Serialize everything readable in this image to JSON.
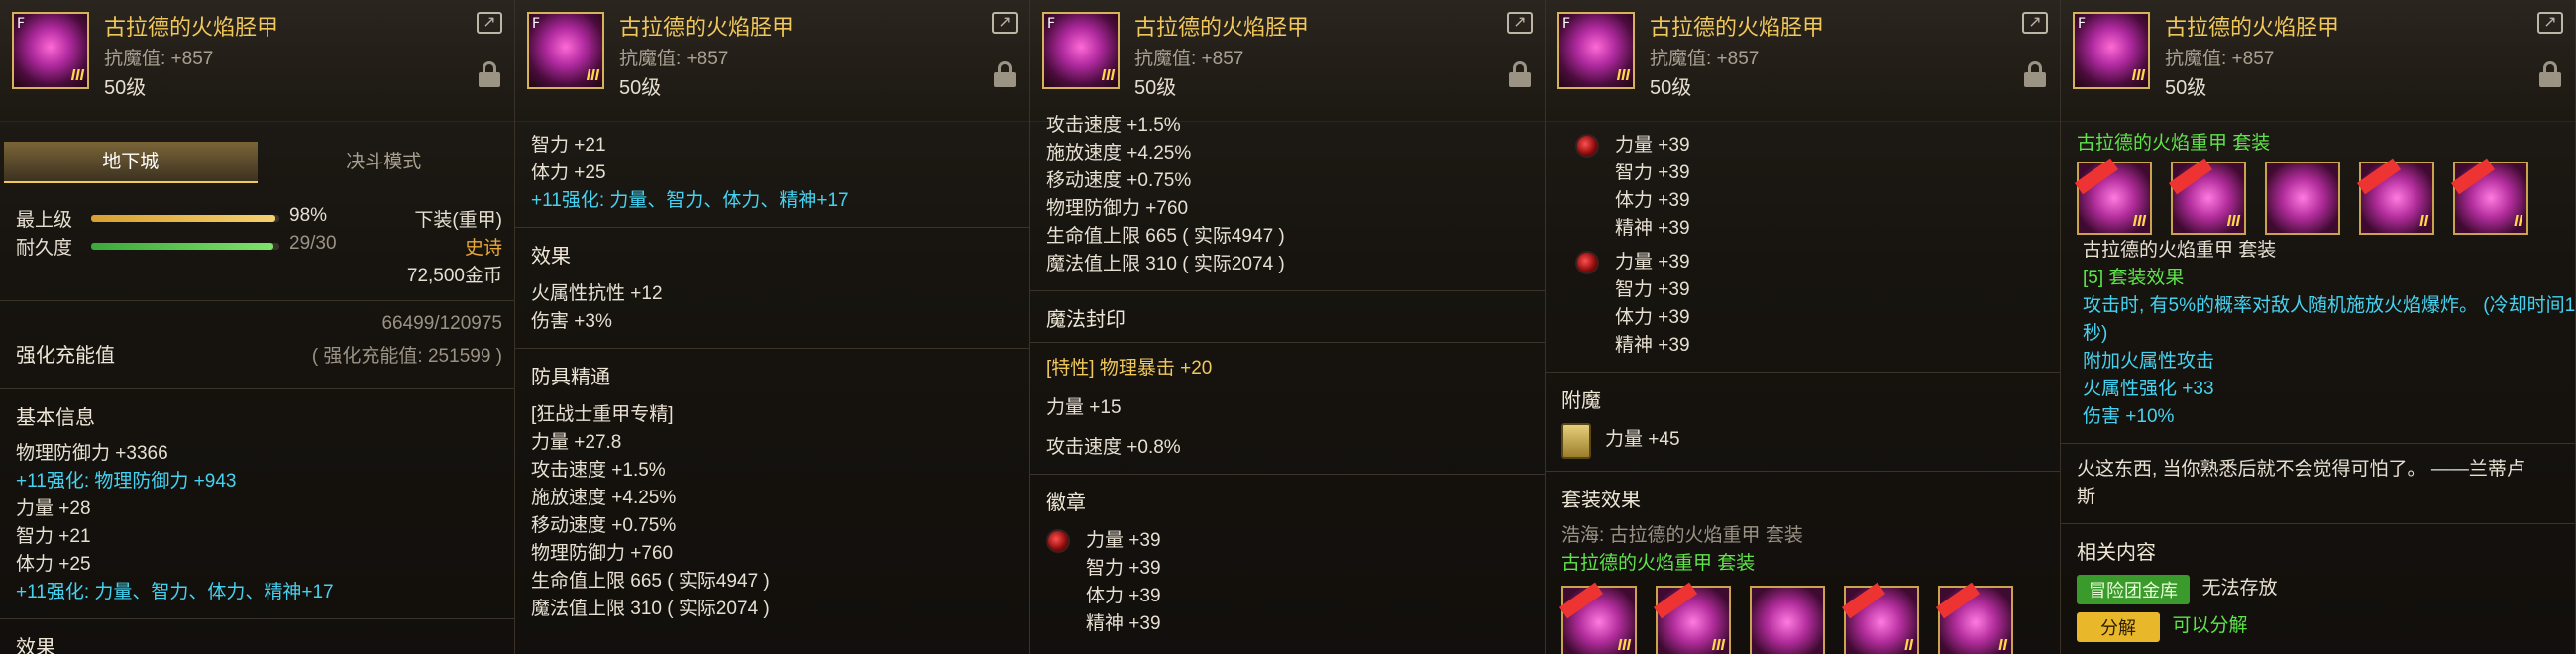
{
  "header": {
    "item_name": "古拉德的火焰胫甲",
    "resist": "抗魔值: +857",
    "level": "50级",
    "icon_tag": "F",
    "icon_grade": "III"
  },
  "panel1": {
    "tabs": [
      "地下城",
      "决斗模式"
    ],
    "grade_label": "最上级",
    "grade_value": "98%",
    "grade_progress": 0.98,
    "durability_label": "耐久度",
    "durability_value": "29/30",
    "durability_progress": 0.967,
    "slot_type": "下装(重甲)",
    "rarity": "史诗",
    "price": "72,500金币",
    "charge_label": "强化充能值",
    "charge_value": "66499/120975",
    "charge_note": "( 强化充能值: 251599 )",
    "basic_title": "基本信息",
    "basic_lines": [
      {
        "text": "物理防御力 +3366",
        "color": "white"
      },
      {
        "text": "+11强化: 物理防御力 +943",
        "color": "blue"
      },
      {
        "text": "力量 +28",
        "color": "white"
      },
      {
        "text": "智力 +21",
        "color": "white"
      },
      {
        "text": "体力 +25",
        "color": "white"
      },
      {
        "text": "+11强化: 力量、智力、体力、精神+17",
        "color": "blue"
      }
    ],
    "effect_title": "效果"
  },
  "panel2": {
    "top_lines": [
      {
        "text": "智力 +21",
        "color": "white"
      },
      {
        "text": "体力 +25",
        "color": "white"
      },
      {
        "text": "+11强化: 力量、智力、体力、精神+17",
        "color": "blue"
      }
    ],
    "effect_title": "效果",
    "effect_lines": [
      "火属性抗性 +12",
      "伤害 +3%"
    ],
    "mastery_title": "防具精通",
    "mastery_lines": [
      "[狂战士重甲专精]",
      "力量 +27.8",
      "攻击速度 +1.5%",
      "施放速度 +4.25%",
      "移动速度 +0.75%",
      "物理防御力 +760",
      "生命值上限 665 ( 实际4947 )",
      "魔法值上限 310 ( 实际2074 )"
    ]
  },
  "panel3": {
    "top_lines": [
      "攻击速度 +1.5%",
      "施放速度 +4.25%",
      "移动速度 +0.75%",
      "物理防御力 +760",
      "生命值上限 665 ( 实际4947 )",
      "魔法值上限 310 ( 实际2074 )"
    ],
    "seal_title": "魔法封印",
    "seal_lines": [
      {
        "text": "[特性] 物理暴击 +20",
        "color": "gold"
      },
      {
        "text": "力量 +15",
        "color": "white"
      },
      {
        "text": "攻击速度 +0.8%",
        "color": "white"
      }
    ],
    "emblem_title": "徽章",
    "emblem_lines": [
      "力量 +39",
      "智力 +39",
      "体力 +39",
      "精神 +39"
    ]
  },
  "panel4": {
    "emblem1": [
      "力量 +39",
      "智力 +39",
      "体力 +39",
      "精神 +39"
    ],
    "emblem2": [
      "力量 +39",
      "智力 +39",
      "体力 +39",
      "精神 +39"
    ],
    "enchant_title": "附魔",
    "enchant_line": "力量 +45",
    "set_title": "套装效果",
    "set_source": "浩海: 古拉德的火焰重甲 套装",
    "set_name": "古拉德的火焰重甲 套装",
    "set_grades": [
      "III",
      "III",
      "",
      "II",
      "II"
    ]
  },
  "panel5": {
    "set_name": "古拉德的火焰重甲 套装",
    "set_grades": [
      "III",
      "III",
      "",
      "II",
      "II"
    ],
    "set_lines": [
      {
        "text": "古拉德的火焰重甲 套装",
        "color": "white"
      },
      {
        "text": "[5] 套装效果",
        "color": "green"
      },
      {
        "text": "攻击时, 有5%的概率对敌人随机施放火焰爆炸。 (冷却时间1",
        "color": "blue"
      },
      {
        "text": "秒)",
        "color": "blue"
      },
      {
        "text": "附加火属性攻击",
        "color": "blue"
      },
      {
        "text": "火属性强化 +33",
        "color": "blue"
      },
      {
        "text": "伤害 +10%",
        "color": "blue"
      }
    ],
    "quote_line1": "火这东西, 当你熟悉后就不会觉得可怕了。 ——兰蒂卢",
    "quote_line2": "斯",
    "related_title": "相关内容",
    "storage_badge": "冒险团金库",
    "storage_text": "无法存放",
    "decompose_button": "分解",
    "decompose_text": "可以分解"
  }
}
